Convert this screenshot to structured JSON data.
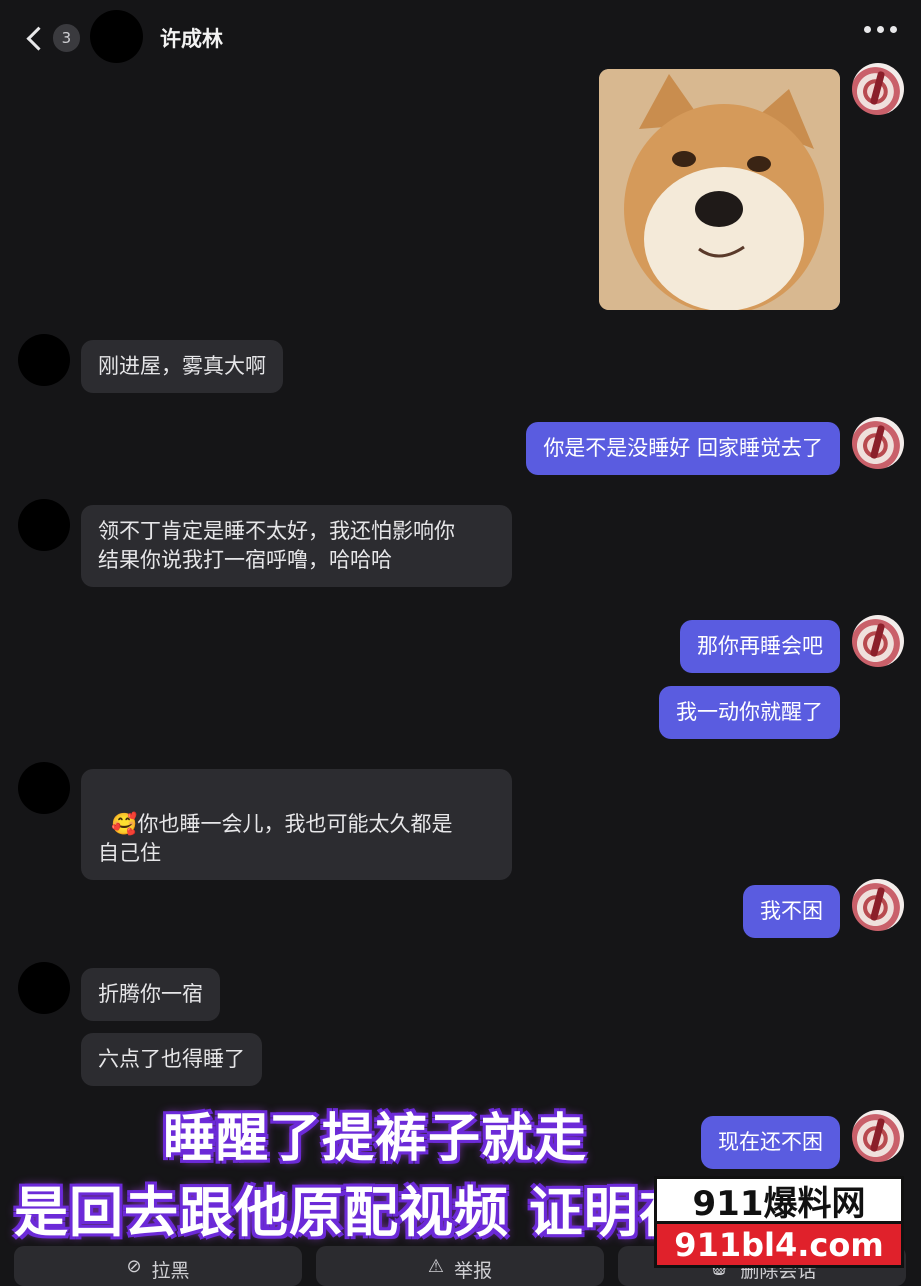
{
  "header": {
    "back_badge": "3",
    "contact_name": "许成林",
    "more_icon": "more-dots-icon"
  },
  "messages": [
    {
      "side": "out",
      "type": "image",
      "alt": "shiba-dog-sticker"
    },
    {
      "side": "in",
      "text": "刚进屋，雾真大啊"
    },
    {
      "side": "out",
      "text": "你是不是没睡好 回家睡觉去了"
    },
    {
      "side": "in",
      "text": "领不丁肯定是睡不太好，我还怕影响你\n结果你说我打一宿呼噜，哈哈哈"
    },
    {
      "side": "out",
      "text": "那你再睡会吧"
    },
    {
      "side": "out",
      "text": "我一动你就醒了"
    },
    {
      "side": "in",
      "emoji": "🥰",
      "text": "你也睡一会儿，我也可能太久都是\n自己住"
    },
    {
      "side": "out",
      "text": "我不困"
    },
    {
      "side": "in",
      "text": "折腾你一宿"
    },
    {
      "side": "in",
      "text": "六点了也得睡了"
    },
    {
      "side": "out",
      "text": "现在还不困"
    }
  ],
  "overlay": {
    "line1": "睡醒了提裤子就走",
    "line2": "是回去跟他原配视频 证明在家"
  },
  "watermark": {
    "top": "911爆料网",
    "bottom": "911bl4.com"
  },
  "bottom_bar": {
    "block": "拉黑",
    "report": "举报",
    "delete": "删除会话"
  }
}
